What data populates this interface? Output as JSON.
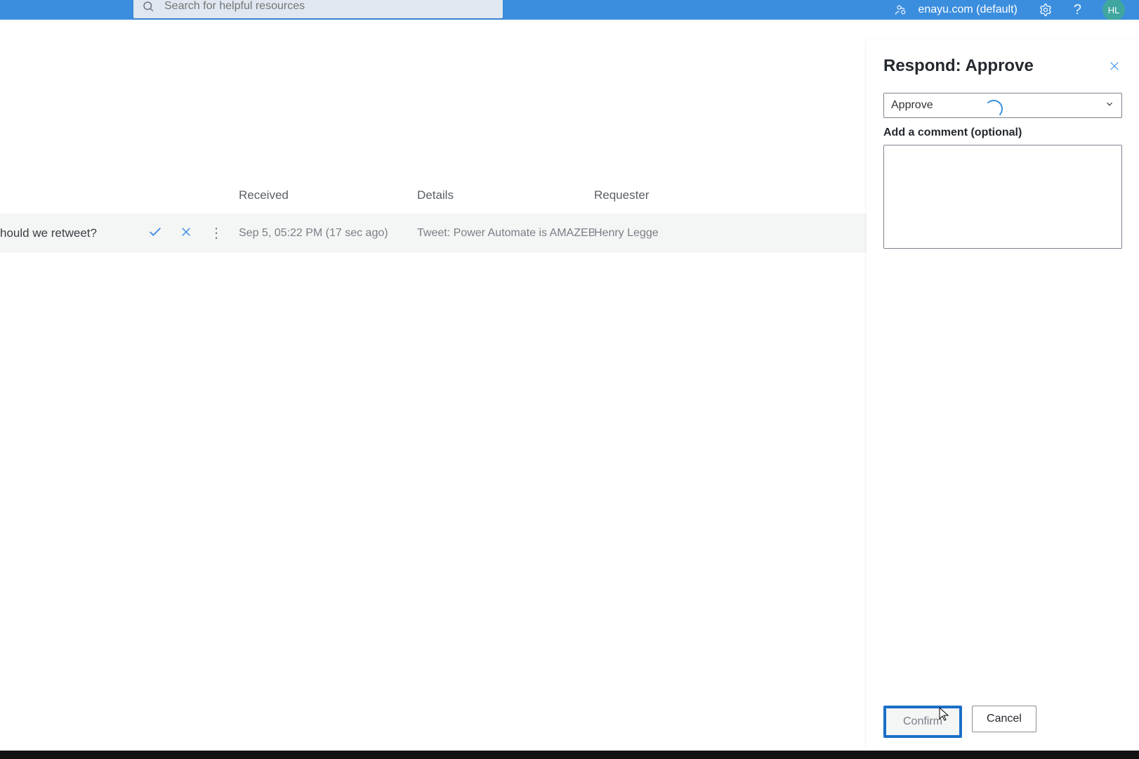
{
  "header": {
    "search_placeholder": "Search for helpful resources",
    "environment": "enayu.com (default)",
    "avatar_initials": "HL"
  },
  "columns": {
    "received": "Received",
    "details": "Details",
    "requester": "Requester"
  },
  "row": {
    "title": "hould we retweet?",
    "received": "Sep 5, 05:22 PM (17 sec ago)",
    "details": "Tweet: Power Automate is AMAZEBA...",
    "requester": "Henry Legge"
  },
  "panel": {
    "title": "Respond: Approve",
    "dropdown_value": "Approve",
    "comment_label": "Add a comment (optional)",
    "confirm": "Confirm",
    "cancel": "Cancel"
  }
}
